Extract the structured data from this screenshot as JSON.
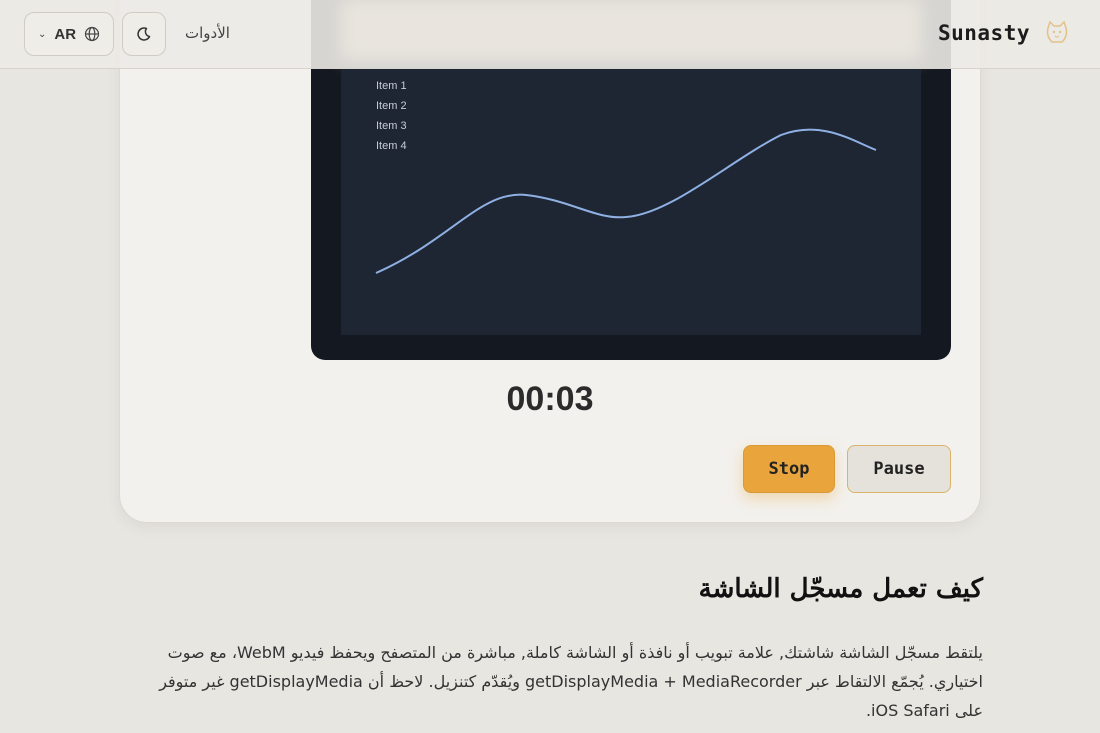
{
  "header": {
    "brand": "Sunasty",
    "tools_link": "الأدوات",
    "language_code": "AR"
  },
  "preview": {
    "items": [
      "Item 1",
      "Item 2",
      "Item 3",
      "Item 4"
    ]
  },
  "recorder": {
    "timer": "00:03",
    "pause_label": "Pause",
    "stop_label": "Stop"
  },
  "article": {
    "title": "كيف تعمل مسجّل الشاشة",
    "body": "يلتقط مسجّل الشاشة شاشتك, علامة تبويب أو نافذة أو الشاشة كاملة, مباشرة من المتصفح ويحفظ فيديو WebM، مع صوت اختياري. يُجمّع الالتقاط عبر getDisplayMedia + MediaRecorder ويُقدّم كتنزيل. لاحظ أن getDisplayMedia غير متوفر على iOS Safari."
  },
  "colors": {
    "accent": "#e9a53c",
    "preview_bg": "#141820",
    "curve": "#8fb0e3"
  }
}
